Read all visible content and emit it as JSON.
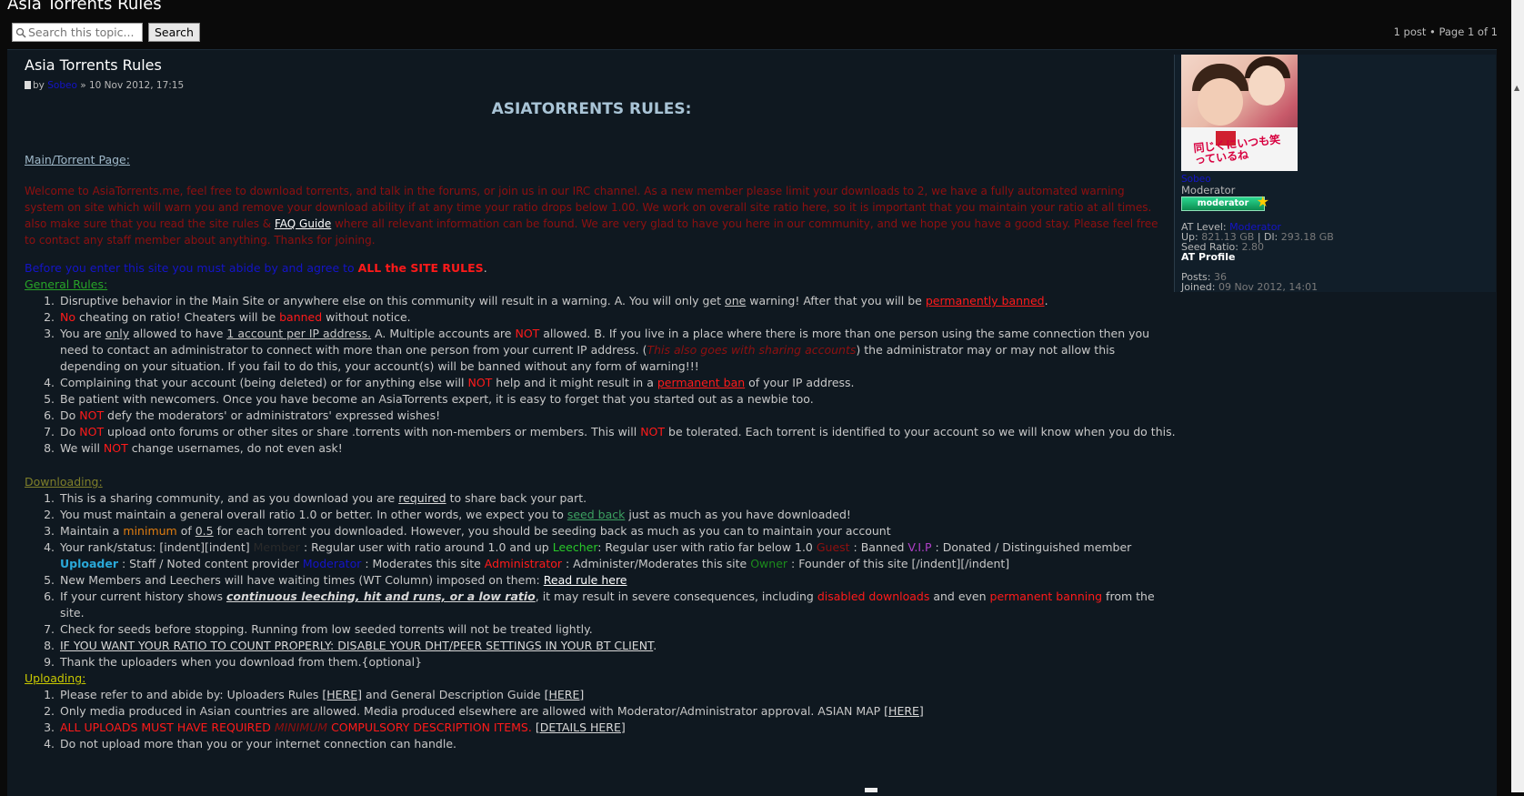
{
  "page": {
    "title": "Asia Torrents Rules",
    "search_placeholder": "Search this topic...",
    "search_button": "Search",
    "pagination": "1 post • Page 1 of 1"
  },
  "post": {
    "title": "Asia Torrents Rules",
    "meta_by": "by",
    "author": "Sobeo",
    "meta_date": "» 10 Nov 2012, 17:15",
    "heading": "ASIATORRENTS RULES:",
    "main_section": "Main/Torrent Page:",
    "welcome_1": "Welcome to AsiaTorrents.me, feel free to download torrents, and talk in the forums, or join us in our IRC channel. As a new member please limit your downloads to 2, we have a fully automated warning system on site which will warn you and remove your download ability if at any time your ratio drops below 1.00. We work on overall site ratio here, so it is important that you maintain your ratio at all times. also make sure that you read the site rules &",
    "faq_link": "FAQ Guide",
    "welcome_2": "where all relevant information can be found. We are very glad to have you here in our community, and we hope you have a good stay. Please feel free to contact any staff member about anything. Thanks for joining.",
    "before_text": "Before you enter this site you must abide by and agree to",
    "site_rules": "ALL the SITE RULES",
    "general_section": "General Rules:",
    "downloading_section": "Downloading:",
    "uploading_section": "Uploading:"
  },
  "general_rules": [
    {
      "a": "Disruptive behavior in the Main Site or anywhere else on this community will result in a warning. A. You will only get ",
      "b": "one",
      "c": " warning! After that you will be ",
      "d": "permanently banned",
      "e": "."
    },
    {
      "a": "No",
      "b": " cheating on ratio! Cheaters will be ",
      "c": "banned",
      "d": " without notice."
    },
    {
      "a": "You are ",
      "b": "only",
      "c": " allowed to have ",
      "d": "1 account per IP address.",
      "e": " A. Multiple accounts are ",
      "f": "NOT",
      "g": " allowed. B. If you live in a place where there is more than one person using the same connection then you need to contact an administrator to connect with more than one person from your current IP address. (",
      "h": "This also goes with sharing accounts",
      "i": ") the administrator may or may not allow this depending on your situation. If you fail to do this, your account(s) will be banned without any form of warning!!!"
    },
    {
      "a": "Complaining that your account (being deleted) or for anything else will ",
      "b": "NOT",
      "c": " help and it might result in a ",
      "d": "permanent ban",
      "e": " of your IP address."
    },
    {
      "a": "Be patient with newcomers. Once you have become an AsiaTorrents expert, it is easy to forget that you started out as a newbie too."
    },
    {
      "a": "Do ",
      "b": "NOT",
      "c": " defy the moderators' or administrators' expressed wishes!"
    },
    {
      "a": "Do ",
      "b": "NOT",
      "c": " upload onto forums or other sites or share .torrents with non-members or members. This will ",
      "d": "NOT",
      "e": " be tolerated. Each torrent is identified to your account so we will know when you do this."
    },
    {
      "a": "We will ",
      "b": "NOT",
      "c": " change usernames, do not even ask!"
    }
  ],
  "download_rules": [
    {
      "a": "This is a sharing community, and as you download you are ",
      "b": "required",
      "c": " to share back your part."
    },
    {
      "a": "You must maintain a general overall ratio 1.0 or better. In other words, we expect you to ",
      "b": "seed back",
      "c": " just as much as you have downloaded!"
    },
    {
      "a": "Maintain a ",
      "b": "minimum",
      "c": " of ",
      "d": "0.5",
      "e": " for each torrent you downloaded. However, you should be seeding back as much as you can to maintain your account"
    },
    {
      "a": "Your rank/status: [indent][indent] ",
      "b": "Member",
      "c": " : Regular user with ratio around 1.0 and up ",
      "d": "Leecher",
      "e": ": Regular user with ratio far below 1.0 ",
      "f": "Guest",
      "g": " : Banned ",
      "h": "V.I.P",
      "i": " : Donated / Distinguished member ",
      "j": "Uploader",
      "k": " : Staff / Noted content provider ",
      "l": "Moderator",
      "m": " : Moderates this site ",
      "n": "Administrator",
      "o": " : Administer/Moderates this site ",
      "p": "Owner",
      "q": " : Founder of this site [/indent][/indent]"
    },
    {
      "a": "New Members and Leechers will have waiting times (WT Column) imposed on them: ",
      "b": "Read rule here"
    },
    {
      "a": "If your current history shows ",
      "b": "continuous leeching, hit and runs, or a low ratio",
      "c": ", it may result in severe consequences, including ",
      "d": "disabled downloads",
      "e": " and even ",
      "f": "permanent banning",
      "g": " from the site."
    },
    {
      "a": "Check for seeds before stopping. Running from low seeded torrents will not be treated lightly."
    },
    {
      "a": "IF YOU WANT YOUR RATIO TO COUNT PROPERLY: DISABLE YOUR DHT/PEER SETTINGS IN YOUR BT CLIENT",
      "b": "."
    },
    {
      "a": "Thank the uploaders when you download from them.{optional}"
    }
  ],
  "upload_rules": [
    {
      "a": "Please refer to and abide by: Uploaders Rules ",
      "b": "[HERE]",
      "c": " and General Description Guide ",
      "d": "[HERE]"
    },
    {
      "a": "Only media produced in Asian countries are allowed. Media produced elsewhere are allowed with Moderator/Administrator approval. ASIAN MAP ",
      "b": "[HERE]"
    },
    {
      "a": "ALL UPLOADS MUST HAVE REQUIRED ",
      "b": "MINIMUM",
      "c": " COMPULSORY DESCRIPTION ITEMS.",
      "d": " ",
      "e": "[DETAILS HERE]"
    },
    {
      "a": "Do not upload more than you or your internet connection can handle."
    }
  ],
  "profile": {
    "avatar_caption": "同じくにいつも笑っているね",
    "username": "Sobeo",
    "rank": "Moderator",
    "badge": "moderator",
    "at_level_label": "AT Level:",
    "at_level_value": "Moderator",
    "up_label": "Up:",
    "up_value": "821.13 GB",
    "sep": "|",
    "dl_label": "Dl:",
    "dl_value": "293.18 GB",
    "seed_label": "Seed Ratio:",
    "seed_value": "2.80",
    "profile_link": "AT Profile",
    "posts_label": "Posts:",
    "posts_value": "36",
    "joined_label": "Joined:",
    "joined_value": "09 Nov 2012, 14:01"
  },
  "colors": {
    "background": "#0a0a0a",
    "panel": "#0f1820",
    "red": "#ff1a1a",
    "dark_red": "#8f1010",
    "link_blue": "#1414c8",
    "green": "#28a428"
  }
}
